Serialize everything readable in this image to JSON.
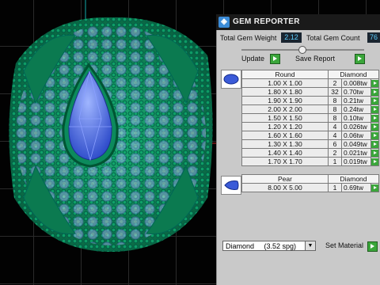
{
  "window": {
    "title": "GEM REPORTER"
  },
  "totals": {
    "weight_label": "Total Gem Weight",
    "weight_value": "2.12",
    "count_label": "Total Gem Count",
    "count_value": "76"
  },
  "buttons": {
    "update": "Update",
    "save_report": "Save Report",
    "set_material": "Set Material"
  },
  "round_table": {
    "shape": "Round",
    "material": "Diamond",
    "rows": [
      {
        "size": "1.00 X 1.00",
        "count": "2",
        "weight": "0.008tw"
      },
      {
        "size": "1.80 X 1.80",
        "count": "32",
        "weight": "0.70tw"
      },
      {
        "size": "1.90 X 1.90",
        "count": "8",
        "weight": "0.21tw"
      },
      {
        "size": "2.00 X 2.00",
        "count": "8",
        "weight": "0.24tw"
      },
      {
        "size": "1.50 X 1.50",
        "count": "8",
        "weight": "0.10tw"
      },
      {
        "size": "1.20 X 1.20",
        "count": "4",
        "weight": "0.026tw"
      },
      {
        "size": "1.60 X 1.60",
        "count": "4",
        "weight": "0.06tw"
      },
      {
        "size": "1.30 X 1.30",
        "count": "6",
        "weight": "0.049tw"
      },
      {
        "size": "1.40 X 1.40",
        "count": "2",
        "weight": "0.021tw"
      },
      {
        "size": "1.70 X 1.70",
        "count": "1",
        "weight": "0.019tw"
      }
    ]
  },
  "pear_table": {
    "shape": "Pear",
    "material": "Diamond",
    "rows": [
      {
        "size": "8.00 X 5.00",
        "count": "1",
        "weight": "0.69tw"
      }
    ]
  },
  "material_select": {
    "value": "Diamond     (3.52 spg)"
  },
  "colors": {
    "metal": "#0c8a5c",
    "stones": "#a8b4ff",
    "center_stone": "#4a6ee8",
    "accent_button": "#3aa63a"
  }
}
